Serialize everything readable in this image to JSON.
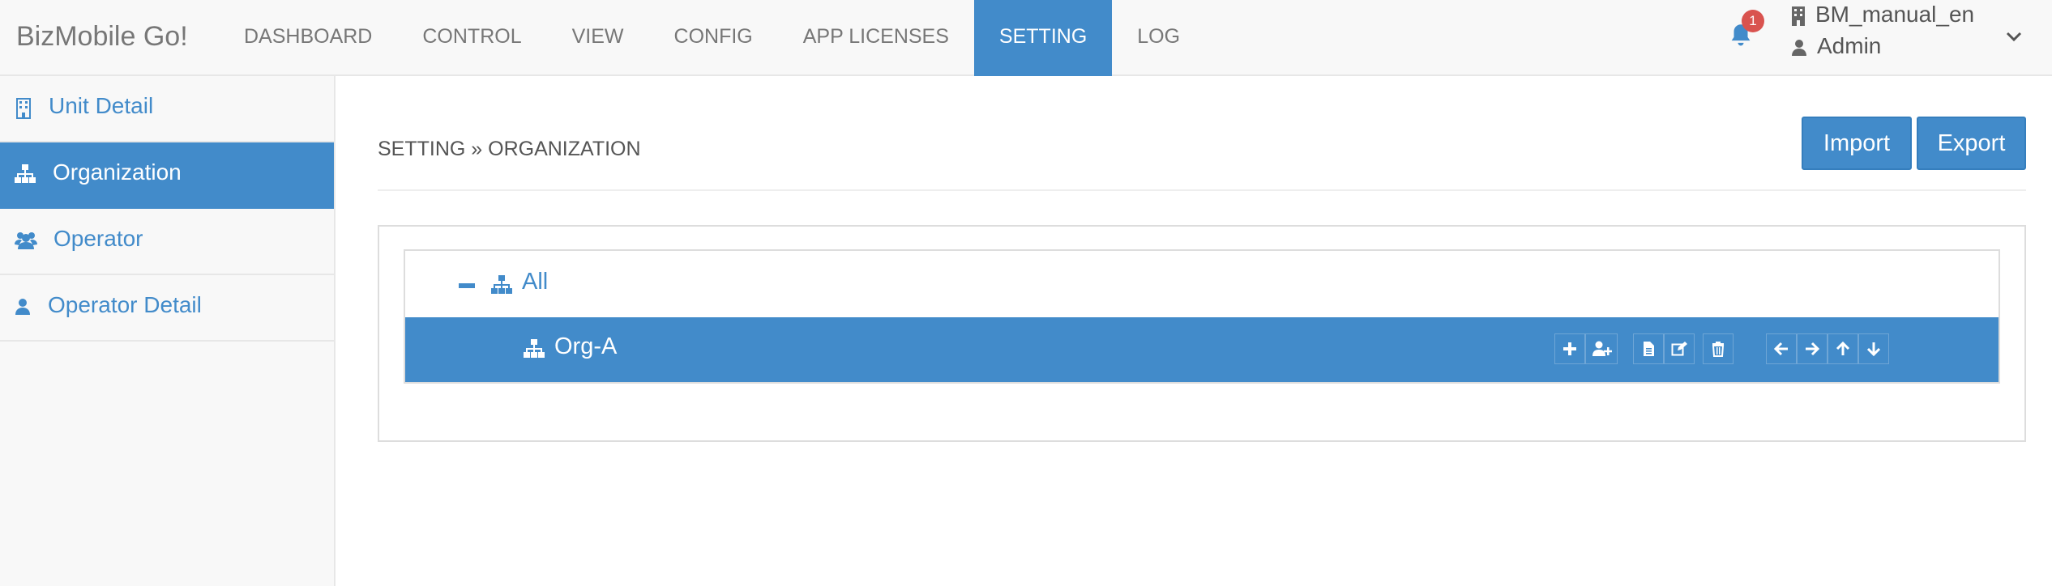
{
  "app": {
    "brand": "BizMobile Go!"
  },
  "nav": {
    "items": [
      "DASHBOARD",
      "CONTROL",
      "VIEW",
      "CONFIG",
      "APP LICENSES",
      "SETTING",
      "LOG"
    ],
    "active": "SETTING"
  },
  "notifications": {
    "count": "1",
    "icon": "bell-icon"
  },
  "user": {
    "organization": "BM_manual_en",
    "name": "Admin"
  },
  "sidebar": {
    "items": [
      {
        "label": "Unit Detail",
        "icon": "building-icon"
      },
      {
        "label": "Organization",
        "icon": "sitemap-icon"
      },
      {
        "label": "Operator",
        "icon": "users-icon"
      },
      {
        "label": "Operator Detail",
        "icon": "user-icon"
      }
    ],
    "active": "Organization"
  },
  "breadcrumb": "SETTING » ORGANIZATION",
  "buttons": {
    "import": "Import",
    "export": "Export"
  },
  "tree": {
    "root": {
      "label": "All",
      "expanded": true
    },
    "children": [
      {
        "label": "Org-A",
        "selected": true,
        "actions": [
          "plus-icon",
          "add-user-icon",
          "document-icon",
          "edit-icon",
          "trash-icon",
          "arrow-left-icon",
          "arrow-right-icon",
          "arrow-up-icon",
          "arrow-down-icon"
        ]
      }
    ]
  },
  "colors": {
    "primary": "#428bca",
    "navbar_bg": "#f8f8f8",
    "badge": "#d9534f",
    "brand_text": "#777777"
  }
}
